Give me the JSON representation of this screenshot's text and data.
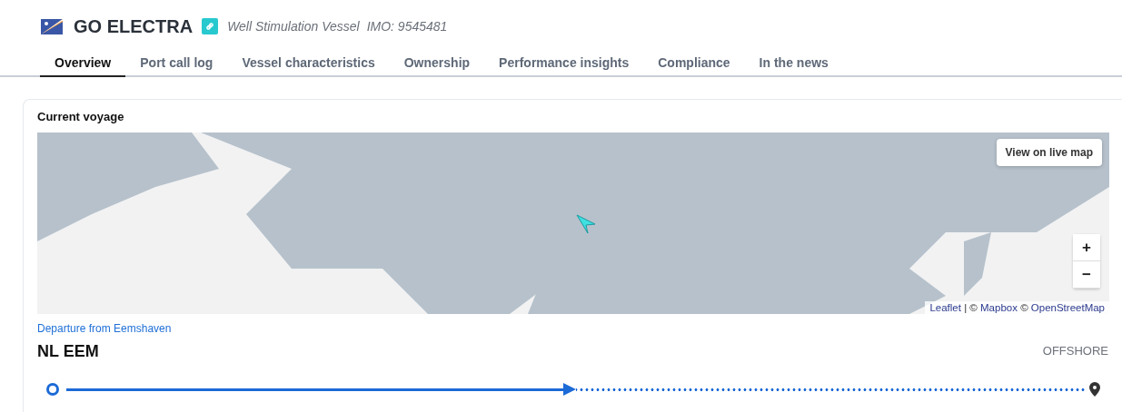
{
  "vessel": {
    "name": "GO ELECTRA",
    "type": "Well Stimulation Vessel",
    "imo": "IMO: 9545481"
  },
  "tabs": [
    {
      "label": "Overview",
      "selected": true
    },
    {
      "label": "Port call log",
      "selected": false
    },
    {
      "label": "Vessel characteristics",
      "selected": false
    },
    {
      "label": "Ownership",
      "selected": false
    },
    {
      "label": "Performance insights",
      "selected": false
    },
    {
      "label": "Compliance",
      "selected": false
    },
    {
      "label": "In the news",
      "selected": false
    }
  ],
  "voyage": {
    "title": "Current voyage",
    "map": {
      "kind": "picture",
      "live_map_button": "View on live map",
      "zoom_in": "+",
      "zoom_out": "−",
      "attribution": [
        {
          "text": "Leaflet",
          "link": true
        },
        {
          "text": " | © ",
          "link": false
        },
        {
          "text": "Mapbox",
          "link": true
        },
        {
          "text": " © ",
          "link": false
        },
        {
          "text": "OpenStreetMap",
          "link": true
        }
      ]
    },
    "departure_label": "Departure from Eemshaven",
    "departure_port": "NL EEM",
    "destination": "OFFSHORE",
    "level": 0.5
  }
}
